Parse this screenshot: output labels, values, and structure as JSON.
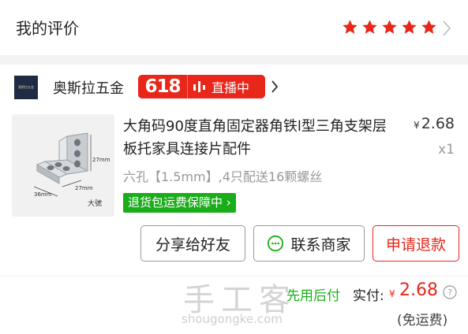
{
  "review": {
    "title": "我的评价",
    "rating": 5,
    "star_color": "#e8261a"
  },
  "shop": {
    "logo_text": "奥斯拉五金",
    "name": "奥斯拉五金",
    "promo_badge": "618",
    "live_label": "直播中",
    "brand_color": "#e8261a"
  },
  "item": {
    "title": "大角码90度直角固定器角铁l型三角支架层板托家具连接片配件",
    "price_symbol": "¥",
    "price": "2.68",
    "quantity": "x1",
    "spec": "六孔【1.5mm】,4只配送16颗螺丝",
    "guarantee": "退货包运费保障中",
    "guarantee_color": "#1aad19",
    "image_labels": {
      "dim_a": "27mm",
      "dim_b": "36mm",
      "dim_c": "27mm",
      "mark": "大號"
    }
  },
  "actions": {
    "share_label": "分享给好友",
    "contact_label": "联系商家",
    "refund_label": "申请退款"
  },
  "payment": {
    "pay_later": "先用后付",
    "paid_label": "实付:",
    "currency": "¥",
    "amount": "2.68",
    "shipping_note": "(免运费)"
  },
  "watermark": {
    "main": "手工客",
    "url": "shougongke.com"
  }
}
